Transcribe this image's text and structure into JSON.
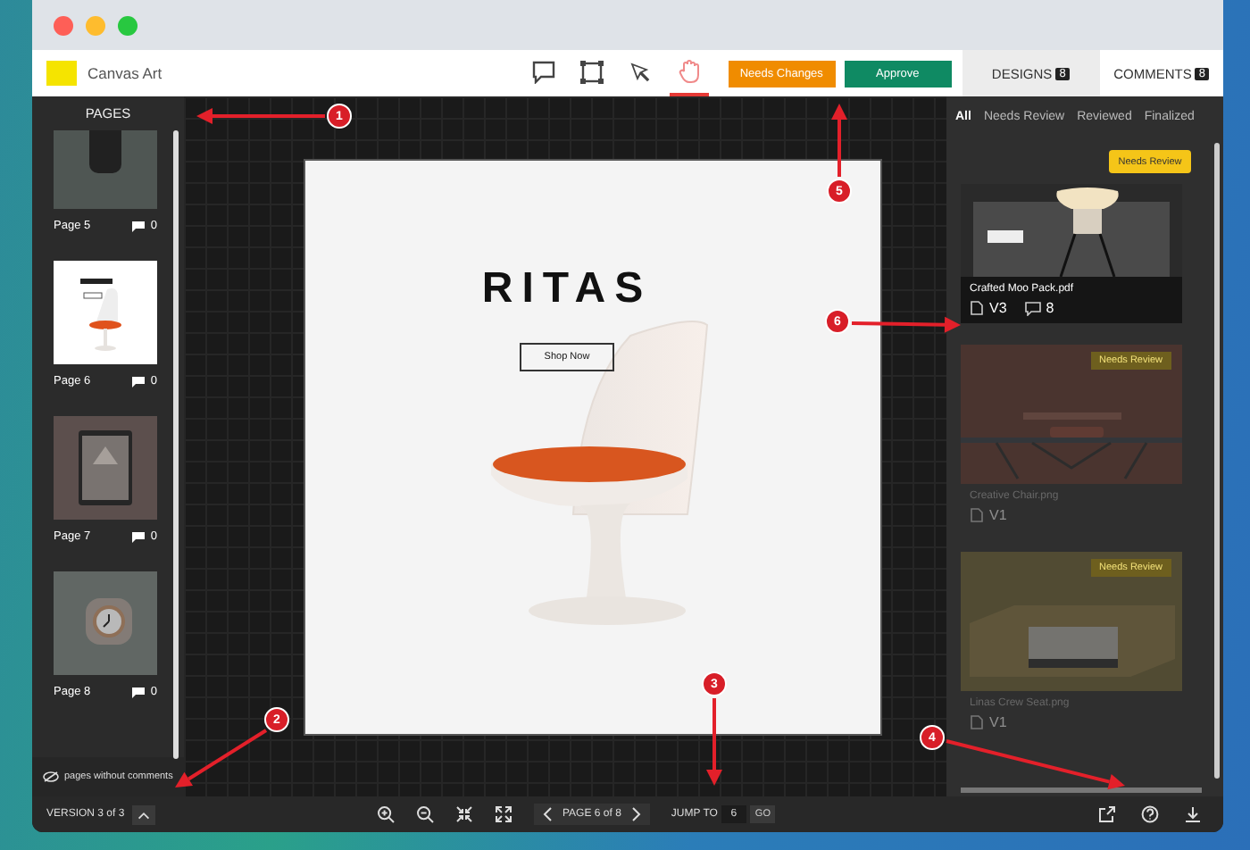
{
  "app": {
    "project": "Canvas Art"
  },
  "tools": [
    {
      "kind": "comment",
      "selected": false
    },
    {
      "kind": "frame",
      "selected": false
    },
    {
      "kind": "pointer",
      "selected": false
    },
    {
      "kind": "hand",
      "selected": true
    }
  ],
  "actions": [
    {
      "label": "Needs Changes",
      "kind": "changes"
    },
    {
      "label": "Approve",
      "kind": "approve"
    }
  ],
  "panel_tabs": [
    {
      "label": "DESIGNS",
      "count": "8",
      "selected": true
    },
    {
      "label": "COMMENTS",
      "count": "8",
      "selected": false
    }
  ],
  "sidebar": {
    "title": "PAGES",
    "pages": [
      {
        "label": "Page 5",
        "comments": "0",
        "selected": false,
        "kind": "speaker"
      },
      {
        "label": "Page 6",
        "comments": "0",
        "selected": true,
        "kind": "chair"
      },
      {
        "label": "Page 7",
        "comments": "0",
        "selected": false,
        "kind": "tablet"
      },
      {
        "label": "Page 8",
        "comments": "0",
        "selected": false,
        "kind": "clock"
      }
    ],
    "footer": "pages without comments"
  },
  "canvas": {
    "headline": "RITAS",
    "button": "Shop Now"
  },
  "designs": {
    "filters": [
      {
        "label": "All",
        "selected": true
      },
      {
        "label": "Needs Review",
        "selected": false
      },
      {
        "label": "Reviewed",
        "selected": false
      },
      {
        "label": "Finalized",
        "selected": false
      }
    ],
    "review_button": "Needs Review",
    "items": [
      {
        "name": "Crafted Moo Pack.pdf",
        "version": "V3",
        "comments": "8",
        "highlighted": true,
        "kind": "lamp"
      },
      {
        "name": "Creative Chair.png",
        "version": "V1",
        "badge": "Needs Review",
        "highlighted": false,
        "kind": "bench"
      },
      {
        "name": "Linas Crew Seat.png",
        "version": "V1",
        "badge": "Needs Review",
        "highlighted": false,
        "kind": "box"
      }
    ]
  },
  "bottom_bar": {
    "version": "VERSION 3 of 3",
    "page": "PAGE 6 of 8",
    "jump_label": "JUMP TO",
    "jump_value": "6",
    "go": "GO"
  },
  "callouts": [
    "1",
    "2",
    "3",
    "4",
    "5",
    "6"
  ]
}
